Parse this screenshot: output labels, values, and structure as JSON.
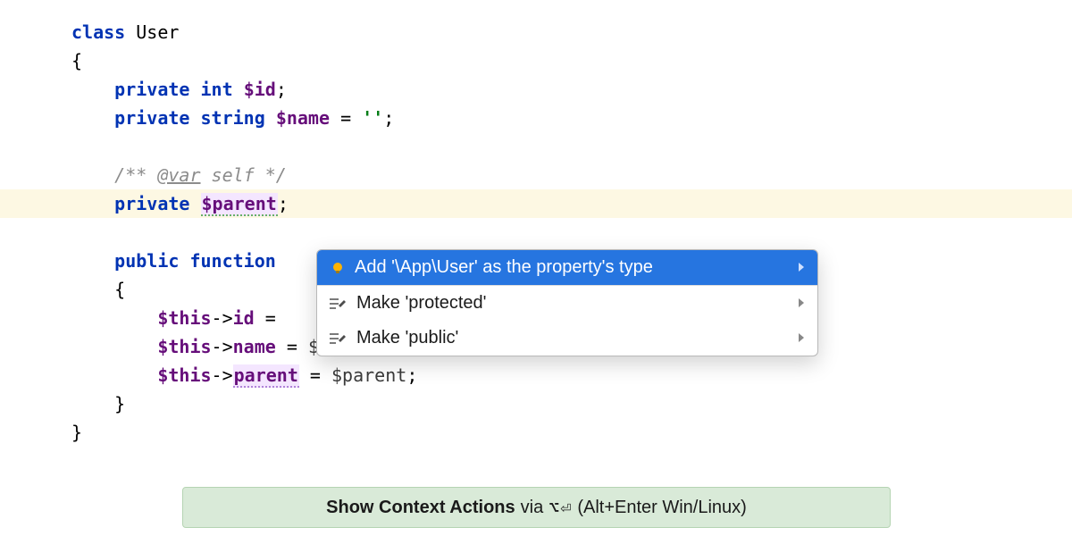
{
  "code": {
    "class_kw": "class",
    "class_name": "User",
    "brace_open": "{",
    "brace_close": "}",
    "private_kw": "private",
    "public_kw": "public",
    "function_kw": "function",
    "int_kw": "int",
    "string_kw": "string",
    "id_var": "$id",
    "name_var": "$name",
    "parent_var": "$parent",
    "empty_str": "''",
    "assign": " = ",
    "semi": ";",
    "doc_open": "/** ",
    "doc_var": "@var",
    "doc_self": " self ",
    "doc_close": "*/",
    "this": "$this",
    "arrow": "->",
    "id_prop": "id",
    "name_prop": "name",
    "parent_prop": "parent",
    "name_param": "$name",
    "parent_param": "$parent"
  },
  "popup": {
    "items": [
      {
        "label": "Add '\\App\\User' as the property's type"
      },
      {
        "label": "Make 'protected'"
      },
      {
        "label": "Make 'public'"
      }
    ]
  },
  "hint": {
    "bold": "Show Context Actions",
    "via": " via ",
    "mac_shortcut": "⌥⏎",
    "win_shortcut": " (Alt+Enter Win/Linux)"
  }
}
